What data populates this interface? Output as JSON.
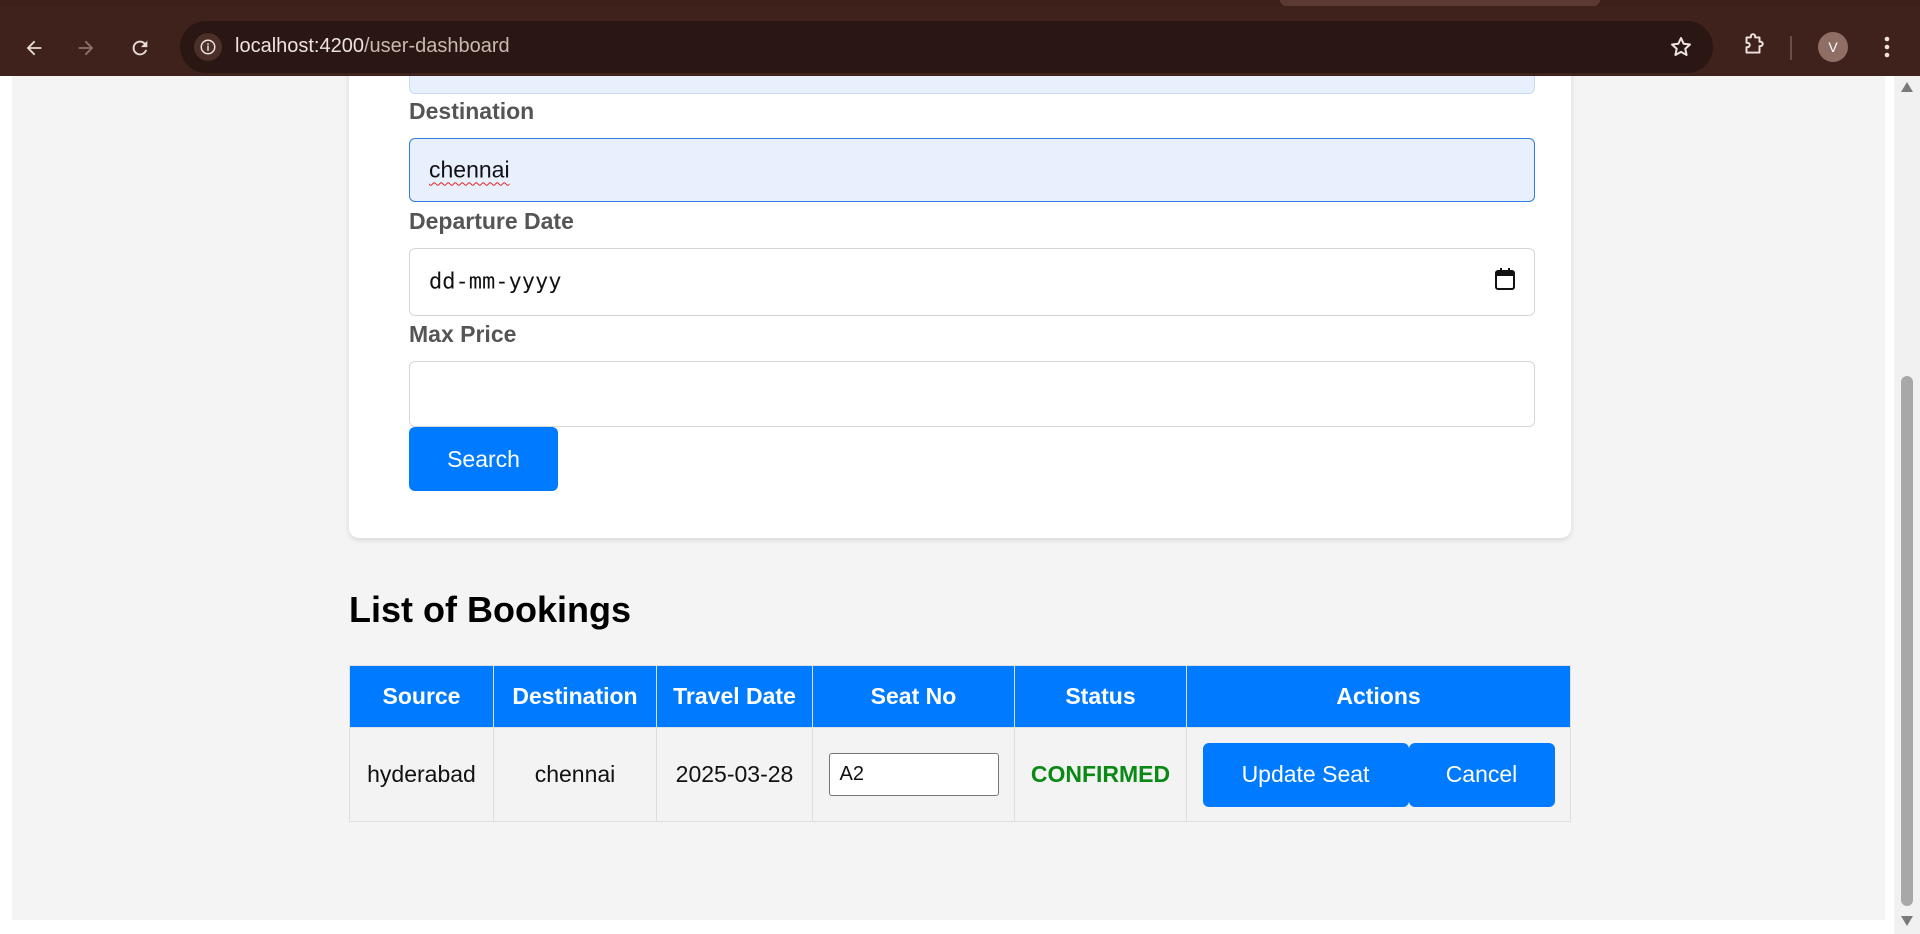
{
  "browser": {
    "url_host": "localhost:4200",
    "url_path": "/user-dashboard",
    "avatar_letter": "V"
  },
  "search_form": {
    "destination_label": "Destination",
    "destination_value": "chennai",
    "departure_label": "Departure Date",
    "departure_placeholder": "dd-mm-yyyy",
    "max_price_label": "Max Price",
    "max_price_value": "",
    "search_button": "Search"
  },
  "bookings": {
    "title": "List of Bookings",
    "columns": [
      "Source",
      "Destination",
      "Travel Date",
      "Seat No",
      "Status",
      "Actions"
    ],
    "rows": [
      {
        "source": "hyderabad",
        "destination": "chennai",
        "travel_date": "2025-03-28",
        "seat_no": "A2",
        "status": "CONFIRMED",
        "update_label": "Update Seat",
        "cancel_label": "Cancel"
      }
    ]
  },
  "colors": {
    "primary": "#007bff",
    "confirmed": "#0a8a14",
    "chrome": "#3f221b"
  },
  "icons": {
    "back": "arrow-left-icon",
    "forward": "arrow-right-icon",
    "reload": "reload-icon",
    "info": "info-icon",
    "bookmark": "star-icon",
    "extensions": "puzzle-icon",
    "menu": "kebab-menu-icon",
    "calendar": "calendar-icon"
  }
}
